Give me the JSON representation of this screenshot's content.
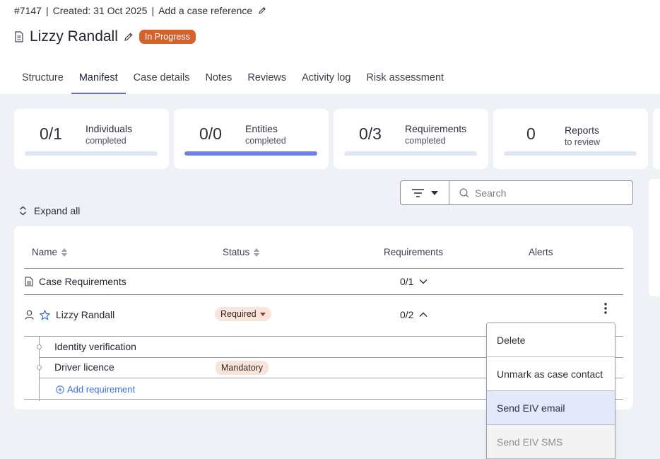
{
  "header": {
    "case_id": "#7147",
    "created": "Created: 31 Oct 2025",
    "add_reference": "Add a case reference",
    "case_name": "Lizzy Randall",
    "status_badge": "In Progress"
  },
  "tabs": [
    {
      "label": "Structure"
    },
    {
      "label": "Manifest",
      "active": true
    },
    {
      "label": "Case details"
    },
    {
      "label": "Notes"
    },
    {
      "label": "Reviews"
    },
    {
      "label": "Activity log"
    },
    {
      "label": "Risk assessment"
    }
  ],
  "summary_cards": [
    {
      "count": "0/1",
      "label": "Individuals",
      "sub": "completed",
      "progress": 0
    },
    {
      "count": "0/0",
      "label": "Entities",
      "sub": "completed",
      "progress": 1
    },
    {
      "count": "0/3",
      "label": "Requirements",
      "sub": "completed",
      "progress": 0
    },
    {
      "count": "0",
      "label": "Reports",
      "sub": "to review",
      "progress": 0
    }
  ],
  "toolbar": {
    "search_placeholder": "Search",
    "expand_all": "Expand all"
  },
  "table": {
    "headers": {
      "name": "Name",
      "status": "Status",
      "requirements": "Requirements",
      "alerts": "Alerts"
    },
    "case_requirements": {
      "label": "Case Requirements",
      "count": "0/1"
    },
    "person": {
      "name": "Lizzy Randall",
      "status": "Required",
      "count": "0/2"
    },
    "sub_items": [
      {
        "label": "Identity verification",
        "status": ""
      },
      {
        "label": "Driver licence",
        "status": "Mandatory"
      }
    ],
    "add_requirement": "Add requirement"
  },
  "context_menu": [
    {
      "label": "Delete",
      "state": "normal"
    },
    {
      "label": "Unmark as case contact",
      "state": "normal"
    },
    {
      "label": "Send EIV email",
      "state": "highlight"
    },
    {
      "label": "Send EIV SMS",
      "state": "disabled"
    }
  ],
  "colors": {
    "accent": "#5b6fd6",
    "badge_in_progress": "#d4622a",
    "pill_bg": "#f7e4da",
    "link": "#3a6fd8",
    "page_bg": "#eef1f6"
  }
}
